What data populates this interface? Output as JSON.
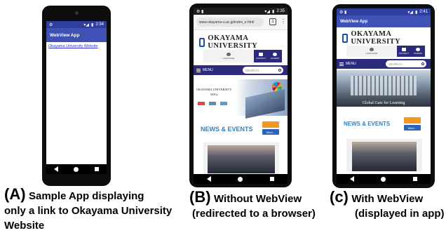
{
  "panel_a": {
    "status_time": "2:34",
    "app_title": "WebView App",
    "link_text": "Okayama University Website",
    "caption_letter": "(A)",
    "caption_line1": "Sample App displaying",
    "caption_line2": "only a link to Okayama University",
    "caption_line3": "Website"
  },
  "panel_b": {
    "status_time": "2:35",
    "url": "www.okayama-u.ac.jp/index_e.html",
    "tab_count": "1",
    "logo_text": "OKAYAMA UNIVERSITY",
    "util": {
      "language": "LANGUAGE",
      "contact": "CONTACT",
      "access": "ACCESS"
    },
    "menu_label": "MENU",
    "search_placeholder": "SEARCH...",
    "banner_line1": "OKAYAMA UNIVERSITY",
    "banner_line2": "SDGs",
    "news_title": "NEWS & EVENTS",
    "more_label": "More...",
    "caption_letter": "(B)",
    "caption_line1": "Without WebView",
    "caption_line2": "(redirected to a browser)"
  },
  "panel_c": {
    "status_time": "2:41",
    "app_title": "WebView App",
    "logo_text": "OKAYAMA UNIVERSITY",
    "util": {
      "language": "LANGUAGE",
      "contact": "CONTACT",
      "access": "ACCESS"
    },
    "menu_label": "MENU",
    "search_placeholder": "SEARCH...",
    "banner_text": "Global Gate for Learning",
    "news_title": "NEWS & EVENTS",
    "more_label": "More...",
    "caption_letter": "(c)",
    "caption_line1": "With WebView",
    "caption_line2": "(displayed in app)"
  },
  "colors": {
    "appbar_blue": "#3f51b5",
    "statusbar_dark": "#303f9f",
    "okayama_navy": "#2c2a7e",
    "news_blue": "#2e82c7",
    "rss_orange": "#f39722"
  }
}
